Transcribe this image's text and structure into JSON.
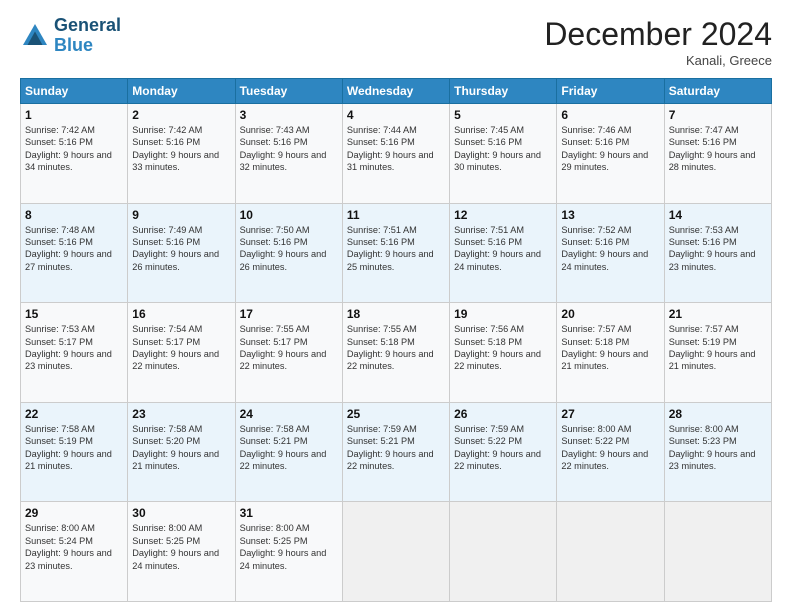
{
  "header": {
    "logo_line1": "General",
    "logo_line2": "Blue",
    "month": "December 2024",
    "location": "Kanali, Greece"
  },
  "weekdays": [
    "Sunday",
    "Monday",
    "Tuesday",
    "Wednesday",
    "Thursday",
    "Friday",
    "Saturday"
  ],
  "weeks": [
    [
      {
        "day": "1",
        "sunrise": "Sunrise: 7:42 AM",
        "sunset": "Sunset: 5:16 PM",
        "daylight": "Daylight: 9 hours and 34 minutes."
      },
      {
        "day": "2",
        "sunrise": "Sunrise: 7:42 AM",
        "sunset": "Sunset: 5:16 PM",
        "daylight": "Daylight: 9 hours and 33 minutes."
      },
      {
        "day": "3",
        "sunrise": "Sunrise: 7:43 AM",
        "sunset": "Sunset: 5:16 PM",
        "daylight": "Daylight: 9 hours and 32 minutes."
      },
      {
        "day": "4",
        "sunrise": "Sunrise: 7:44 AM",
        "sunset": "Sunset: 5:16 PM",
        "daylight": "Daylight: 9 hours and 31 minutes."
      },
      {
        "day": "5",
        "sunrise": "Sunrise: 7:45 AM",
        "sunset": "Sunset: 5:16 PM",
        "daylight": "Daylight: 9 hours and 30 minutes."
      },
      {
        "day": "6",
        "sunrise": "Sunrise: 7:46 AM",
        "sunset": "Sunset: 5:16 PM",
        "daylight": "Daylight: 9 hours and 29 minutes."
      },
      {
        "day": "7",
        "sunrise": "Sunrise: 7:47 AM",
        "sunset": "Sunset: 5:16 PM",
        "daylight": "Daylight: 9 hours and 28 minutes."
      }
    ],
    [
      {
        "day": "8",
        "sunrise": "Sunrise: 7:48 AM",
        "sunset": "Sunset: 5:16 PM",
        "daylight": "Daylight: 9 hours and 27 minutes."
      },
      {
        "day": "9",
        "sunrise": "Sunrise: 7:49 AM",
        "sunset": "Sunset: 5:16 PM",
        "daylight": "Daylight: 9 hours and 26 minutes."
      },
      {
        "day": "10",
        "sunrise": "Sunrise: 7:50 AM",
        "sunset": "Sunset: 5:16 PM",
        "daylight": "Daylight: 9 hours and 26 minutes."
      },
      {
        "day": "11",
        "sunrise": "Sunrise: 7:51 AM",
        "sunset": "Sunset: 5:16 PM",
        "daylight": "Daylight: 9 hours and 25 minutes."
      },
      {
        "day": "12",
        "sunrise": "Sunrise: 7:51 AM",
        "sunset": "Sunset: 5:16 PM",
        "daylight": "Daylight: 9 hours and 24 minutes."
      },
      {
        "day": "13",
        "sunrise": "Sunrise: 7:52 AM",
        "sunset": "Sunset: 5:16 PM",
        "daylight": "Daylight: 9 hours and 24 minutes."
      },
      {
        "day": "14",
        "sunrise": "Sunrise: 7:53 AM",
        "sunset": "Sunset: 5:16 PM",
        "daylight": "Daylight: 9 hours and 23 minutes."
      }
    ],
    [
      {
        "day": "15",
        "sunrise": "Sunrise: 7:53 AM",
        "sunset": "Sunset: 5:17 PM",
        "daylight": "Daylight: 9 hours and 23 minutes."
      },
      {
        "day": "16",
        "sunrise": "Sunrise: 7:54 AM",
        "sunset": "Sunset: 5:17 PM",
        "daylight": "Daylight: 9 hours and 22 minutes."
      },
      {
        "day": "17",
        "sunrise": "Sunrise: 7:55 AM",
        "sunset": "Sunset: 5:17 PM",
        "daylight": "Daylight: 9 hours and 22 minutes."
      },
      {
        "day": "18",
        "sunrise": "Sunrise: 7:55 AM",
        "sunset": "Sunset: 5:18 PM",
        "daylight": "Daylight: 9 hours and 22 minutes."
      },
      {
        "day": "19",
        "sunrise": "Sunrise: 7:56 AM",
        "sunset": "Sunset: 5:18 PM",
        "daylight": "Daylight: 9 hours and 22 minutes."
      },
      {
        "day": "20",
        "sunrise": "Sunrise: 7:57 AM",
        "sunset": "Sunset: 5:18 PM",
        "daylight": "Daylight: 9 hours and 21 minutes."
      },
      {
        "day": "21",
        "sunrise": "Sunrise: 7:57 AM",
        "sunset": "Sunset: 5:19 PM",
        "daylight": "Daylight: 9 hours and 21 minutes."
      }
    ],
    [
      {
        "day": "22",
        "sunrise": "Sunrise: 7:58 AM",
        "sunset": "Sunset: 5:19 PM",
        "daylight": "Daylight: 9 hours and 21 minutes."
      },
      {
        "day": "23",
        "sunrise": "Sunrise: 7:58 AM",
        "sunset": "Sunset: 5:20 PM",
        "daylight": "Daylight: 9 hours and 21 minutes."
      },
      {
        "day": "24",
        "sunrise": "Sunrise: 7:58 AM",
        "sunset": "Sunset: 5:21 PM",
        "daylight": "Daylight: 9 hours and 22 minutes."
      },
      {
        "day": "25",
        "sunrise": "Sunrise: 7:59 AM",
        "sunset": "Sunset: 5:21 PM",
        "daylight": "Daylight: 9 hours and 22 minutes."
      },
      {
        "day": "26",
        "sunrise": "Sunrise: 7:59 AM",
        "sunset": "Sunset: 5:22 PM",
        "daylight": "Daylight: 9 hours and 22 minutes."
      },
      {
        "day": "27",
        "sunrise": "Sunrise: 8:00 AM",
        "sunset": "Sunset: 5:22 PM",
        "daylight": "Daylight: 9 hours and 22 minutes."
      },
      {
        "day": "28",
        "sunrise": "Sunrise: 8:00 AM",
        "sunset": "Sunset: 5:23 PM",
        "daylight": "Daylight: 9 hours and 23 minutes."
      }
    ],
    [
      {
        "day": "29",
        "sunrise": "Sunrise: 8:00 AM",
        "sunset": "Sunset: 5:24 PM",
        "daylight": "Daylight: 9 hours and 23 minutes."
      },
      {
        "day": "30",
        "sunrise": "Sunrise: 8:00 AM",
        "sunset": "Sunset: 5:25 PM",
        "daylight": "Daylight: 9 hours and 24 minutes."
      },
      {
        "day": "31",
        "sunrise": "Sunrise: 8:00 AM",
        "sunset": "Sunset: 5:25 PM",
        "daylight": "Daylight: 9 hours and 24 minutes."
      },
      null,
      null,
      null,
      null
    ]
  ]
}
